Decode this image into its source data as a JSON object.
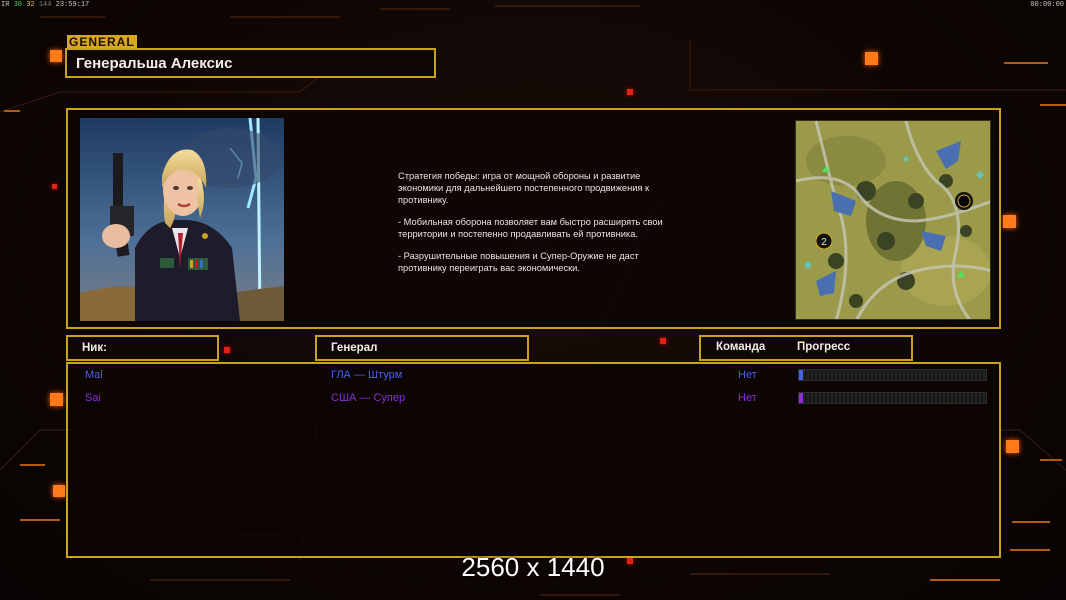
{
  "status_bar": {
    "fps": "30",
    "rate": "32",
    "frames": "144",
    "clock": "23:59:17",
    "right_time": "00:00:00",
    "prefix": "IR"
  },
  "general_tag": "GENERAL",
  "general_name": "Генеральша Алексис",
  "description": {
    "p1": "Стратегия победы: игра от мощной обороны и развитие\n экономики для дальнейшего постепенного продвижения к\n противнику.",
    "p2": "- Мобильная оборона позволяет вам быстро расширять свои\n территории и постепенно продавливать ей противника.",
    "p3": "- Разрушительные повышения и Супер-Оружие не даст\n противнику переиграть вас экономически."
  },
  "minimap": {
    "marker_label": "2"
  },
  "columns": {
    "nick": "Ник:",
    "general": "Генерал",
    "team": "Команда",
    "progress": "Прогресс"
  },
  "players": [
    {
      "nick": "Mal",
      "general": "ГЛА — Штурм",
      "team": "Нет",
      "color": "#4a5ef0",
      "progress": 0.01
    },
    {
      "nick": "Sai",
      "general": "США — Супер",
      "team": "Нет",
      "color": "#8a2ee0",
      "progress": 0.02
    }
  ],
  "resolution_label": "2560 x 1440",
  "colors": {
    "gold": "#c9a31e",
    "accent_orange": "#ff7a1a"
  }
}
